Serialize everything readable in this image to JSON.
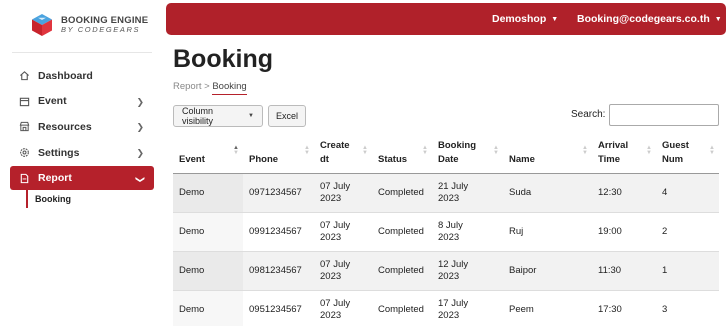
{
  "brand": {
    "title": "BOOKING ENGINE",
    "subtitle": "BY CODEGEARS"
  },
  "sidebar": {
    "items": [
      {
        "label": "Dashboard",
        "icon": "home-icon",
        "has_chevron": false
      },
      {
        "label": "Event",
        "icon": "calendar-icon",
        "has_chevron": true
      },
      {
        "label": "Resources",
        "icon": "store-icon",
        "has_chevron": true
      },
      {
        "label": "Settings",
        "icon": "gear-icon",
        "has_chevron": true
      },
      {
        "label": "Report",
        "icon": "document-icon",
        "has_chevron": true,
        "active": true
      }
    ],
    "sub_items": [
      {
        "label": "Booking",
        "active": true
      }
    ]
  },
  "topbar": {
    "shop": "Demoshop",
    "user": "Booking@codegears.co.th"
  },
  "page": {
    "title": "Booking",
    "breadcrumb_parent": "Report",
    "breadcrumb_current": "Booking"
  },
  "toolbar": {
    "column_visibility": "Column visibility",
    "excel": "Excel",
    "search_label": "Search:",
    "search_value": ""
  },
  "table": {
    "headers": [
      [
        "Event"
      ],
      [
        "Phone"
      ],
      [
        "Create",
        "dt"
      ],
      [
        "Status"
      ],
      [
        "Booking",
        "Date"
      ],
      [
        "Name"
      ],
      [
        "Arrival",
        "Time"
      ],
      [
        "Guest",
        "Num"
      ]
    ],
    "rows": [
      {
        "event": "Demo",
        "phone": "0971234567",
        "create_dt": [
          "07 July",
          "2023"
        ],
        "status": "Completed",
        "booking_date": [
          "21 July",
          "2023"
        ],
        "name": "Suda",
        "arrival_time": "12:30",
        "guest_num": "4"
      },
      {
        "event": "Demo",
        "phone": "0991234567",
        "create_dt": [
          "07 July",
          "2023"
        ],
        "status": "Completed",
        "booking_date": [
          "8 July",
          "2023"
        ],
        "name": "Ruj",
        "arrival_time": "19:00",
        "guest_num": "2"
      },
      {
        "event": "Demo",
        "phone": "0981234567",
        "create_dt": [
          "07 July",
          "2023"
        ],
        "status": "Completed",
        "booking_date": [
          "12 July",
          "2023"
        ],
        "name": "Baipor",
        "arrival_time": "11:30",
        "guest_num": "1"
      },
      {
        "event": "Demo",
        "phone": "0951234567",
        "create_dt": [
          "07 July",
          "2023"
        ],
        "status": "Completed",
        "booking_date": [
          "17 July",
          "2023"
        ],
        "name": "Peem",
        "arrival_time": "17:30",
        "guest_num": "3"
      }
    ]
  },
  "colors": {
    "accent": "#b0212a",
    "logo_top": "#4aa3df",
    "logo_bottom": "#c8232c"
  }
}
